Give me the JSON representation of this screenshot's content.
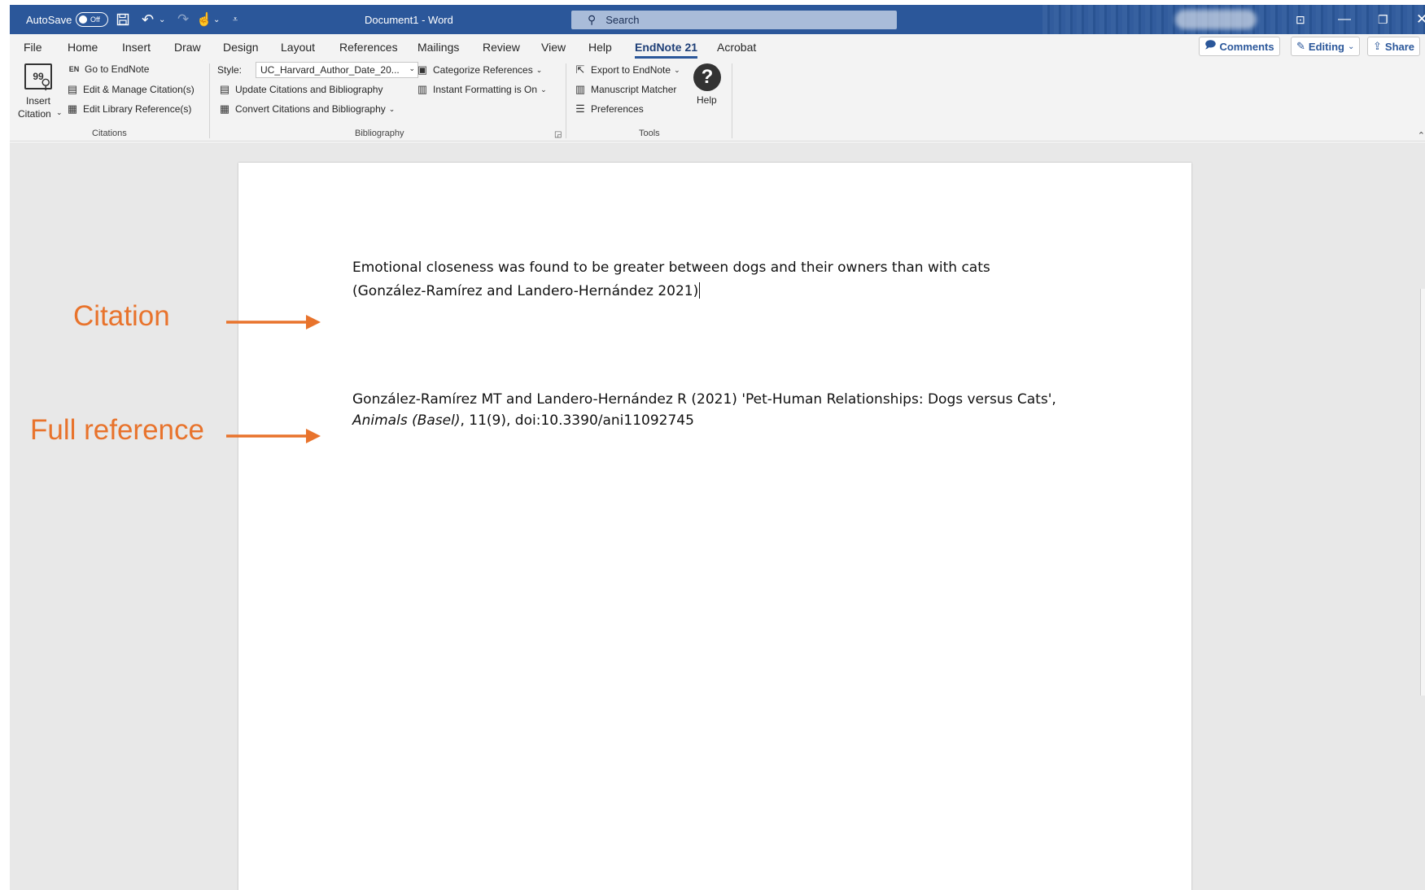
{
  "window": {
    "autosave_label": "AutoSave",
    "autosave_state": "Off",
    "doc_title": "Document1  -  Word",
    "search_placeholder": "Search"
  },
  "tabs": [
    "File",
    "Home",
    "Insert",
    "Draw",
    "Design",
    "Layout",
    "References",
    "Mailings",
    "Review",
    "View",
    "Help",
    "EndNote 21",
    "Acrobat"
  ],
  "active_tab": "EndNote 21",
  "right_buttons": {
    "comments": "Comments",
    "editing": "Editing",
    "share": "Share"
  },
  "ribbon": {
    "citations": {
      "insert_citation_line1": "Insert",
      "insert_citation_line2": "Citation",
      "go_to_endnote": "Go to EndNote",
      "edit_manage": "Edit & Manage Citation(s)",
      "edit_library": "Edit Library Reference(s)",
      "group_label": "Citations"
    },
    "bibliography": {
      "style_label": "Style:",
      "style_value": "UC_Harvard_Author_Date_20...",
      "update": "Update Citations and Bibliography",
      "convert": "Convert Citations and Bibliography",
      "categorize": "Categorize References",
      "instant_formatting": "Instant Formatting is On",
      "group_label": "Bibliography"
    },
    "tools": {
      "export": "Export to EndNote",
      "manuscript": "Manuscript Matcher",
      "preferences": "Preferences",
      "help": "Help",
      "group_label": "Tools"
    }
  },
  "document": {
    "citation_line1": "Emotional closeness was found to be greater between dogs and their owners than with cats",
    "citation_line2": "(González-Ramírez and Landero-Hernández 2021)",
    "reference_line1": "González-Ramírez MT and Landero-Hernández R (2021) 'Pet-Human Relationships: Dogs versus Cats',",
    "reference_journal": "Animals (Basel)",
    "reference_rest": ", 11(9), doi:10.3390/ani11092745"
  },
  "annotations": {
    "citation_label": "Citation",
    "reference_label": "Full reference",
    "accent_color": "#e8732c"
  },
  "colors": {
    "title_bar": "#2b579a",
    "ribbon_bg": "#f3f3f3",
    "canvas_bg": "#e8e8e8"
  }
}
